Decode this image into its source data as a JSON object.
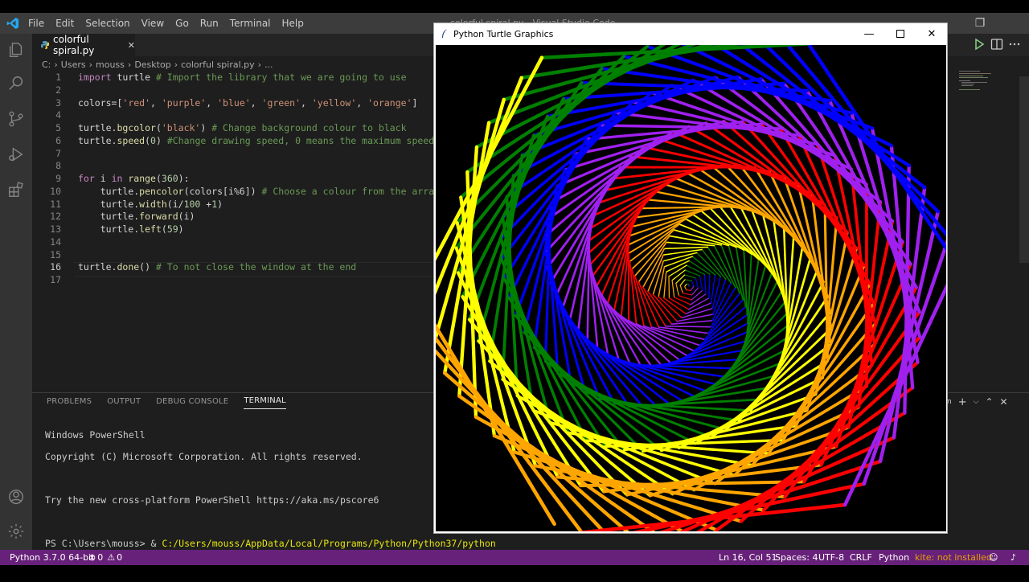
{
  "vscode": {
    "title": "colorful spiral.py - Visual Studio Code",
    "menu": [
      "File",
      "Edit",
      "Selection",
      "View",
      "Go",
      "Run",
      "Terminal",
      "Help"
    ],
    "window_controls": {
      "minimize": "—",
      "restore": "❐",
      "close": "✕"
    }
  },
  "tab": {
    "label": "colorful spiral.py",
    "close": "✕"
  },
  "breadcrumb": [
    "C:",
    "Users",
    "mouss",
    "Desktop",
    "colorful spiral.py",
    "..."
  ],
  "code": {
    "active_line": 16,
    "lines": [
      {
        "n": "1",
        "html": "<span class=\"kw\">import</span> turtle <span class=\"cm\"># Import the library that we are going to use</span>"
      },
      {
        "n": "2",
        "html": ""
      },
      {
        "n": "3",
        "html": "colors=[<span class=\"str\">'red'</span>, <span class=\"str\">'purple'</span>, <span class=\"str\">'blue'</span>, <span class=\"str\">'green'</span>, <span class=\"str\">'yellow'</span>, <span class=\"str\">'orange'</span>]"
      },
      {
        "n": "4",
        "html": ""
      },
      {
        "n": "5",
        "html": "turtle.<span class=\"fn\">bgcolor</span>(<span class=\"str\">'black'</span>) <span class=\"cm\"># Change background colour to black</span>"
      },
      {
        "n": "6",
        "html": "turtle.<span class=\"fn\">speed</span>(<span class=\"num\">0</span>) <span class=\"cm\">#Change drawing speed, 0 means the maximum speed</span>"
      },
      {
        "n": "7",
        "html": ""
      },
      {
        "n": "8",
        "html": ""
      },
      {
        "n": "9",
        "html": "<span class=\"kw\">for</span> i <span class=\"kw\">in</span> <span class=\"fn\">range</span>(<span class=\"num\">360</span>):"
      },
      {
        "n": "10",
        "html": "    turtle.<span class=\"fn\">pencolor</span>(colors[i%6]) <span class=\"cm\"># Choose a colour from the array</span>"
      },
      {
        "n": "11",
        "html": "    turtle.<span class=\"fn\">width</span>(i/<span class=\"num\">100</span> +<span class=\"num\">1</span>)"
      },
      {
        "n": "12",
        "html": "    turtle.<span class=\"fn\">forward</span>(i)"
      },
      {
        "n": "13",
        "html": "    turtle.<span class=\"fn\">left</span>(<span class=\"num\">59</span>)"
      },
      {
        "n": "14",
        "html": ""
      },
      {
        "n": "15",
        "html": ""
      },
      {
        "n": "16",
        "html": "turtle.<span class=\"fn\">done</span>() <span class=\"cm\"># To not close the window at the end</span>"
      },
      {
        "n": "17",
        "html": ""
      }
    ]
  },
  "panel": {
    "tabs": [
      "PROBLEMS",
      "OUTPUT",
      "DEBUG CONSOLE",
      "TERMINAL"
    ],
    "active_tab": "TERMINAL",
    "tools_label": "ion",
    "terminal": {
      "line1": "Windows PowerShell",
      "line2": "Copyright (C) Microsoft Corporation. All rights reserved.",
      "line3": "Try the new cross-platform PowerShell https://aka.ms/pscore6",
      "prompt": "PS C:\\Users\\mouss> & ",
      "command": "C:/Users/mouss/AppData/Local/Programs/Python/Python37/python"
    }
  },
  "status": {
    "python": "Python 3.7.0 64-bit",
    "errors": "0",
    "warnings": "0",
    "position": "Ln 16, Col 51",
    "spaces": "Spaces: 4",
    "encoding": "UTF-8",
    "eol": "CRLF",
    "language": "Python",
    "kite": "kite: not installed",
    "color": "#68217a"
  },
  "turtle_window": {
    "title": "Python Turtle Graphics",
    "bg": "#000000",
    "colors": [
      "red",
      "purple",
      "blue",
      "green",
      "yellow",
      "orange"
    ],
    "iterations": 360,
    "turn_angle": 59
  }
}
